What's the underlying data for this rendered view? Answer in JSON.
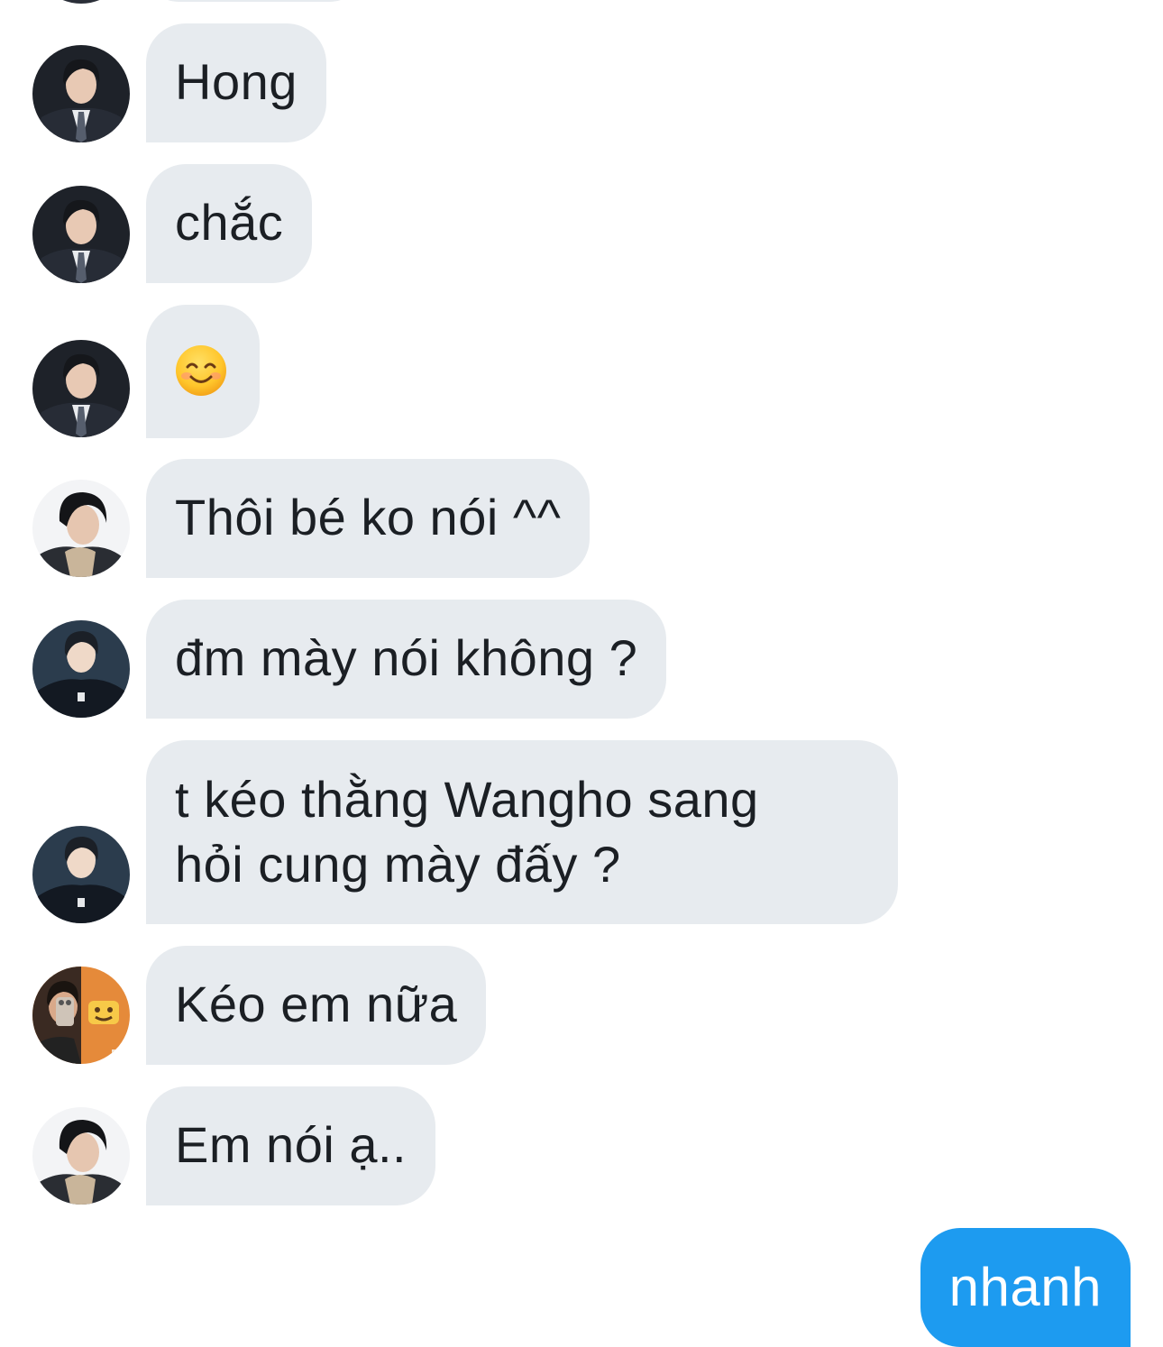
{
  "colors": {
    "incoming_bubble": "#e7ebef",
    "outgoing_bubble": "#1d9bf0",
    "incoming_text": "#1b1f24",
    "outgoing_text": "#ffffff"
  },
  "messages": [
    {
      "sender_avatar": "avatar-suit-boy",
      "text": "Hong"
    },
    {
      "sender_avatar": "avatar-suit-boy",
      "text": "chắc"
    },
    {
      "sender_avatar": "avatar-suit-boy",
      "emoji": "smiling-face-emoji"
    },
    {
      "sender_avatar": "avatar-scarf-boy",
      "text": "Thôi bé ko nói ^^"
    },
    {
      "sender_avatar": "avatar-dark-jacket-boy",
      "text": "đm mày nói không ?"
    },
    {
      "sender_avatar": "avatar-dark-jacket-boy",
      "text": "t kéo thằng Wangho sang\nhỏi cung mày đấy ?"
    },
    {
      "sender_avatar": "avatar-mirror-selfie",
      "text": "Kéo em nữa"
    },
    {
      "sender_avatar": "avatar-scarf-boy",
      "text": "Em nói ạ.."
    }
  ],
  "outgoing": {
    "text": "nhanh"
  }
}
